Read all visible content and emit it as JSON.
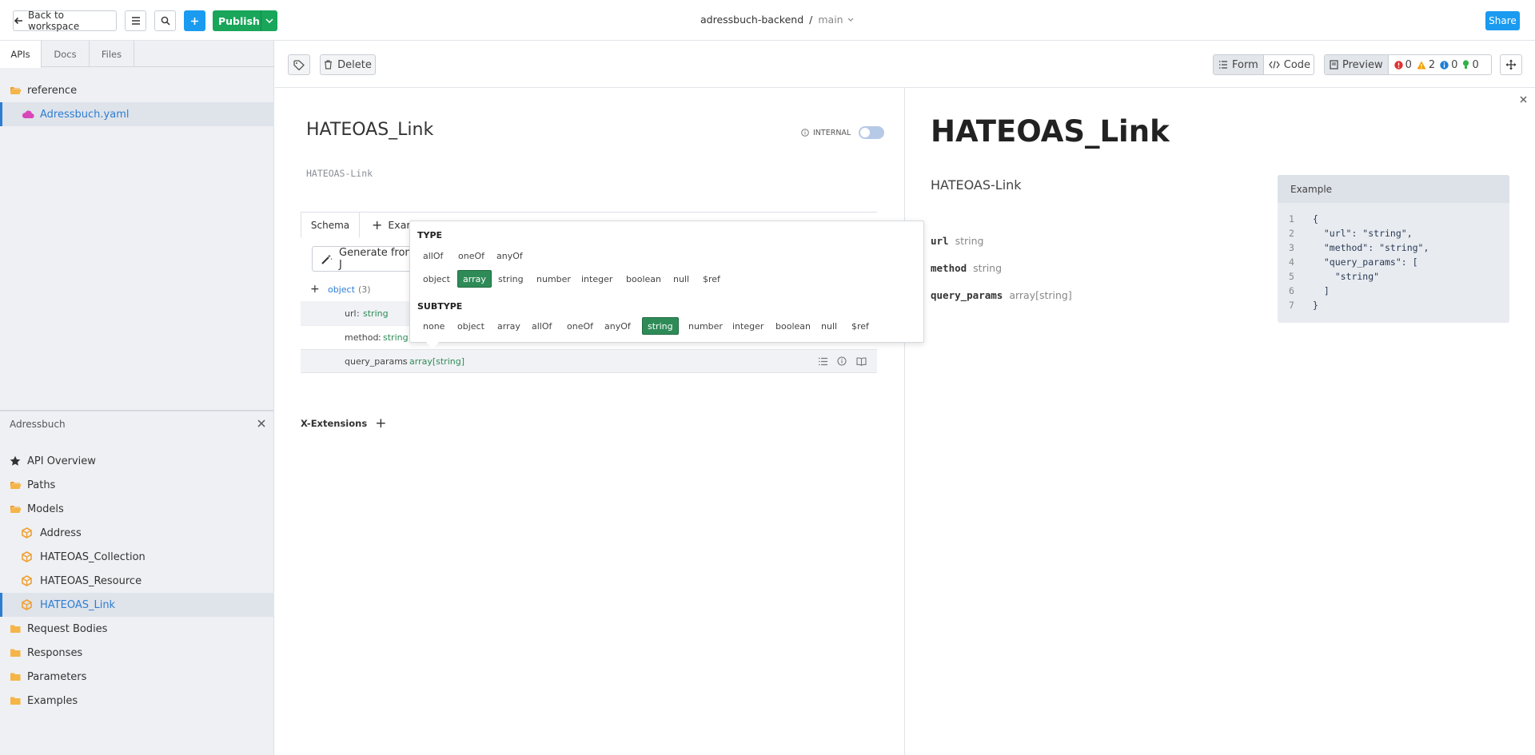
{
  "topbar": {
    "back_label": "Back to workspace",
    "publish_label": "Publish",
    "project": "adressbuch-backend",
    "separator": "/",
    "branch": "main",
    "share_label": "Share"
  },
  "sidebar": {
    "tabs": [
      "APIs",
      "Docs",
      "Files"
    ],
    "folder": "reference",
    "file": "Adressbuch.yaml",
    "section_title": "Adressbuch",
    "items": [
      {
        "label": "API Overview",
        "icon": "star-icon"
      },
      {
        "label": "Paths",
        "icon": "folder-icon"
      },
      {
        "label": "Models",
        "icon": "folder-icon"
      },
      {
        "label": "Address",
        "icon": "cube-icon"
      },
      {
        "label": "HATEOAS_Collection",
        "icon": "cube-icon"
      },
      {
        "label": "HATEOAS_Resource",
        "icon": "cube-icon"
      },
      {
        "label": "HATEOAS_Link",
        "icon": "cube-icon",
        "active": true
      },
      {
        "label": "Request Bodies",
        "icon": "folder-icon"
      },
      {
        "label": "Responses",
        "icon": "folder-icon"
      },
      {
        "label": "Parameters",
        "icon": "folder-icon"
      },
      {
        "label": "Examples",
        "icon": "folder-icon"
      }
    ]
  },
  "toolbar": {
    "delete_label": "Delete",
    "form_label": "Form",
    "code_label": "Code",
    "preview_label": "Preview",
    "errors": "0",
    "warnings": "2",
    "infos": "0",
    "hints": "0"
  },
  "editor": {
    "title": "HATEOAS_Link",
    "internal_label": "INTERNAL",
    "description": "HATEOAS-Link",
    "tabs": {
      "schema": "Schema",
      "examples": "Exam"
    },
    "generate_label": "Generate from J",
    "root_type": "object",
    "root_count": "(3)",
    "properties": [
      {
        "name": "url",
        "type": "string"
      },
      {
        "name": "method",
        "type": "string"
      },
      {
        "name": "query_params",
        "type": "array[string]"
      }
    ],
    "colon": ":",
    "x_extensions_label": "X-Extensions"
  },
  "type_popup": {
    "type_heading": "TYPE",
    "combinators": [
      "allOf",
      "oneOf",
      "anyOf"
    ],
    "types": [
      "object",
      "array",
      "string",
      "number",
      "integer",
      "boolean",
      "null",
      "$ref"
    ],
    "selected_type": "array",
    "subtype_heading": "SUBTYPE",
    "subtypes": [
      "none",
      "object",
      "array",
      "allOf",
      "oneOf",
      "anyOf",
      "string",
      "number",
      "integer",
      "boolean",
      "null",
      "$ref"
    ],
    "selected_subtype": "string"
  },
  "preview": {
    "title": "HATEOAS_Link",
    "description": "HATEOAS-Link",
    "properties": [
      {
        "name": "url",
        "type": "string"
      },
      {
        "name": "method",
        "type": "string"
      },
      {
        "name": "query_params",
        "type": "array[string]"
      }
    ],
    "example_title": "Example",
    "example_lines": [
      {
        "n": "1",
        "text": "{"
      },
      {
        "n": "2",
        "text": "  \"url\": \"string\","
      },
      {
        "n": "3",
        "text": "  \"method\": \"string\","
      },
      {
        "n": "4",
        "text": "  \"query_params\": ["
      },
      {
        "n": "5",
        "text": "    \"string\""
      },
      {
        "n": "6",
        "text": "  ]"
      },
      {
        "n": "7",
        "text": "}"
      }
    ]
  },
  "colors": {
    "accent_blue": "#1a9bf0",
    "publish_green": "#19a55a",
    "selected_chip": "#2e8b57",
    "model_icon_orange": "#f0a030",
    "error_red": "#e03131",
    "warning_orange": "#f59f00"
  }
}
